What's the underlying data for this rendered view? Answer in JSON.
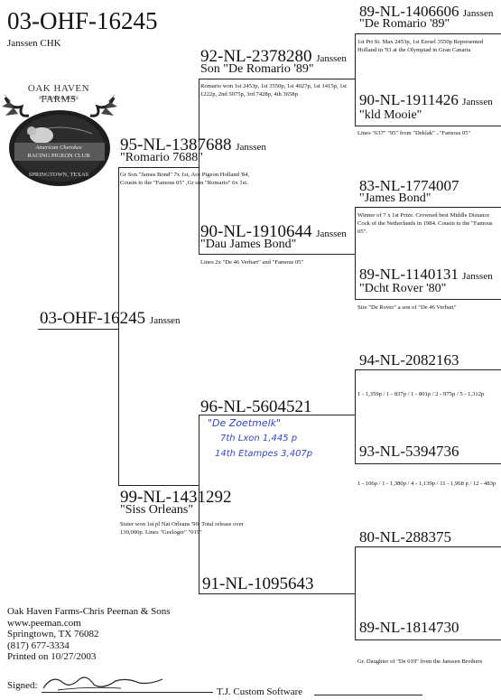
{
  "header": {
    "ring": "03-OHF-16245",
    "breeder": "Janssen CHK"
  },
  "logo": {
    "top_text": "OAK HAVEN FARMS",
    "sub_text": "PEEMAN & SONS",
    "band_line1": "American Cherokee",
    "band_line2": "RACING PIGEON CLUB",
    "bottom_text": "SPRINGTOWN, TEXAS"
  },
  "subject": {
    "ring": "03-OHF-16245",
    "suffix": "Janssen"
  },
  "sire": {
    "ring": "95-NL-1387688",
    "suffix": "Janssen",
    "name": "\"Romario 7688\"",
    "note": "Gr Son \"James Bond\" 7x 1st, Ace Pigeon Holland '84, Cousin to the \"Famous 05\" ,Gr son \"Romario\" 6x 1st."
  },
  "ss": {
    "ring": "92-NL-2378280",
    "suffix": "Janssen",
    "name": "Son \"De Romario '89\"",
    "note": "Romario won 1st 2453p, 1st 3550p, 1st 4027p, 1st 1415p, 1st 1222p, 2nd 5075p, 3rd 7428p, 4th 3658p"
  },
  "sss": {
    "ring": "89-NL-1406606",
    "suffix": "Janssen",
    "name": "\"De Romario '89\"",
    "note": "1st Prt St. Max 2453p, 1st Eersel 3550p Represented Holland in '93 at the Olympiad in Gran Canaria"
  },
  "ssd": {
    "ring": "90-NL-1911426",
    "suffix": "Janssen",
    "name": "\"kld Mooie\"",
    "note": "Lines \"637\" \"95\" from \"Deklak\" ..\"Famous 05\""
  },
  "sd": {
    "ring": "90-NL-1910644",
    "suffix": "Janssen",
    "name": "\"Dau James Bond\"",
    "note": "Lines 2x \"De 46 Verbart\" and \"Famous 05\""
  },
  "sds": {
    "ring": "83-NL-1774007",
    "name": "\"James Bond\"",
    "note": "Winner of 7 x 1st Prize. Crowned best Middle Distance Cock of the Netherlands in 1984. Cousin to the \"Famous 05\"."
  },
  "sdd": {
    "ring": "89-NL-1140131",
    "suffix": "Janssen",
    "name": "\"Dcht Rover '80\"",
    "note": "Sire \"De Rover\" a son of \"De 46 Verbart\""
  },
  "dam": {
    "ring": "99-NL-1431292",
    "name": "\"Siss Orleans\"",
    "note": "Sister won 1st pl Nat Orleans '99. Total release over 130,000p. Lines \"Geeloger\" \"019\""
  },
  "ds": {
    "ring": "96-NL-5604521",
    "hand1": "\"De Zoetmelk\"",
    "hand2": "7th Lxon 1,445 p",
    "hand3": "14th Etampes 3,407p"
  },
  "dss": {
    "ring": "94-NL-2082163",
    "note": "1 - 1,359p / 1 - 837p / 1 - 801p / 2 - 975p / 5 - 1,312p"
  },
  "dsd": {
    "ring": "93-NL-5394736",
    "note": "1 - 106p / 1 - 1,380p / 4 - 1,139p / 11 - 1,968 p / 12 - 483p"
  },
  "dd": {
    "ring": "91-NL-1095643"
  },
  "dds": {
    "ring": "80-NL-288375"
  },
  "ddd": {
    "ring": "89-NL-1814730",
    "note": "Gr. Daughter of \"De 019\" from the Janssen Brothers"
  },
  "footer": {
    "company": "Oak Haven Farms-Chris Peeman & Sons",
    "website": "www.peeman.com",
    "address": "Springtown, TX 76082",
    "phone": "(817) 677-3334",
    "printed": "Printed on 10/27/2003",
    "signed_label": "Signed:",
    "software": "T.J. Custom Software"
  }
}
